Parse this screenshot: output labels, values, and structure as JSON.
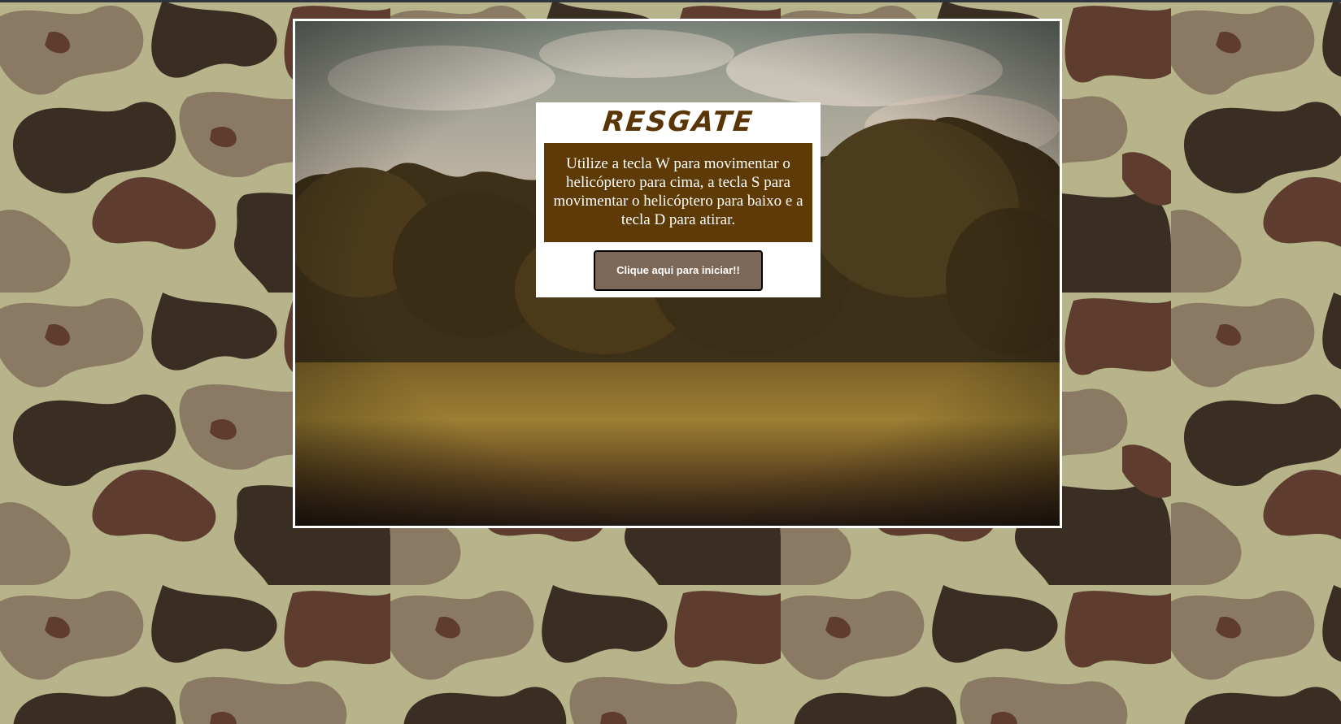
{
  "game": {
    "title": "RESGATE",
    "instructions": "Utilize a tecla W para movimentar o helicóptero para cima, a tecla S para movimentar o helicóptero para baixo e a tecla D para atirar.",
    "start_button_label": "Clique aqui para iniciar!!"
  },
  "colors": {
    "camo_light": "#b7b48c",
    "camo_mid": "#8a7a64",
    "camo_dark": "#3a2e22",
    "camo_brown": "#5e3d2e",
    "panel_background": "#ffffff",
    "title": "#5a3505",
    "instructions_background": "#5e3a06",
    "button_background": "#7d6756",
    "frame_border": "#ffffff"
  },
  "icons": {
    "background": "camouflage-pattern",
    "scene": "forest-landscape"
  }
}
